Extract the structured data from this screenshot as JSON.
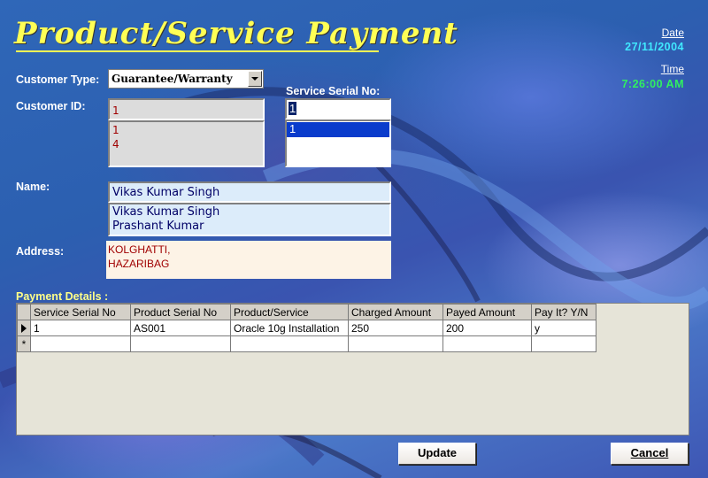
{
  "form": {
    "title": "Product/Service Payment",
    "date_label": "Date",
    "date_value": "27/11/2004",
    "time_label": "Time",
    "time_value": "7:26:00 AM"
  },
  "customer_type": {
    "label": "Customer Type:",
    "selected": "Guarantee/Warranty"
  },
  "customer_id": {
    "label": "Customer ID:",
    "value": "1",
    "list": [
      "1",
      "4"
    ]
  },
  "service_serial": {
    "label": "Service Serial No:",
    "value": "1",
    "list": [
      "1"
    ]
  },
  "name": {
    "label": "Name:",
    "value": "Vikas Kumar Singh",
    "list": [
      "Vikas Kumar Singh",
      "Prashant Kumar"
    ]
  },
  "address": {
    "label": "Address:",
    "lines": [
      "KOLGHATTI,",
      "HAZARIBAG"
    ]
  },
  "payment": {
    "label": "Payment Details :",
    "columns": [
      "Service Serial No",
      "Product Serial No",
      "Product/Service",
      "Charged Amount",
      "Payed Amount",
      "Pay It? Y/N"
    ],
    "rows": [
      [
        "1",
        "AS001",
        "Oracle 10g Installation",
        "250",
        "200",
        "y"
      ]
    ],
    "new_row_marker": "*"
  },
  "buttons": {
    "update": "Update",
    "cancel": "Cancel"
  },
  "colors": {
    "title": "#ffff55",
    "date": "#40e8ff",
    "time": "#30f060",
    "list_selection": "#0a3ccc"
  }
}
